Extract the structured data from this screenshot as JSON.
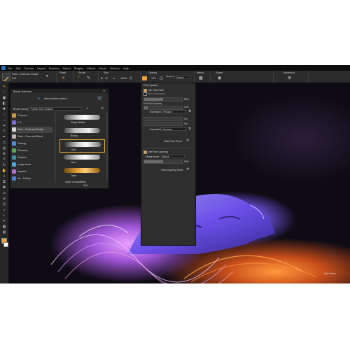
{
  "menubar": {
    "items": [
      "File",
      "Edit",
      "Canvas",
      "Layers",
      "Brushes",
      "Select",
      "Shapes",
      "Effects",
      "Movie",
      "Window",
      "Help"
    ]
  },
  "propbar": {
    "brush_category": "Paint - Build and Sculpt",
    "brush_variant": "Soft",
    "sections": {
      "reset": "Reset",
      "stroke": "Stroke",
      "size": "Size",
      "opacity": "Opacity",
      "media": "Media",
      "shape": "Shape",
      "advanced": "Advanced"
    },
    "size_value": "20",
    "opacity_value": "13%",
    "percent_2": "100%",
    "merge_mode_label": "Merge mode",
    "merge_mode_value": "Default"
  },
  "brush_selector": {
    "title": "Brush Selector",
    "new_brushes": "New brushes added...",
    "library_label": "Brush Library:",
    "library_value": "Painter 2021 Brushes",
    "categories": [
      {
        "label": "Crayons",
        "color": "#c99a3c"
      },
      {
        "label": "F-X",
        "color": "#7a6bd8"
      },
      {
        "label": "Paint - Build and Sculpt",
        "color": "#d8d8d8"
      },
      {
        "label": "Paint - Pure and Blend",
        "color": "#b8b8b8"
      },
      {
        "label": "Glazing",
        "color": "#4f8ad6"
      },
      {
        "label": "Gouache",
        "color": "#59a65f"
      },
      {
        "label": "Graphic",
        "color": "#3f8fa8"
      },
      {
        "label": "Image Hose",
        "color": "#46a8d8"
      },
      {
        "label": "Impasto",
        "color": "#b06fd0"
      },
      {
        "label": "Ink - Rolltop",
        "color": "#4a7fd0"
      }
    ],
    "variants": [
      {
        "label": "Shape Builder"
      },
      {
        "label": "Blocky"
      },
      {
        "label": "Soft"
      },
      {
        "label": "Hard"
      },
      {
        "label": "Taper"
      }
    ],
    "layer_compat": "Layer compatibility",
    "layer_compat_value": "Soft"
  },
  "opacity_panel": {
    "paint_opacity": "Paint Opacity",
    "use_fluid_paint": "Use Fluid Paint",
    "fill_to_flat": "Fill to Flat layers",
    "paint_opacity_row": "Paint Opacity",
    "paint_opacity_val": "50%",
    "min_fluid_opacity": "Min Fluid Opacity",
    "min_fluid_val": "10%",
    "expression_label": "Expression",
    "expression_value": "Pressure",
    "row_a": "Accumulation",
    "row_a_val": "0%",
    "row_b": "Min Accumulation",
    "row_b_val": "0%",
    "expression2_value": "Pressure",
    "fluid_paint_reset": "Fluid Paint Reset",
    "use_paint_layering": "Use Paint Layering",
    "merge_mode_label": "Merge mode",
    "merge_mode_value": "Default",
    "paint_layer_opacity": "Paint Layer Opacity",
    "paint_layer_val": "50%",
    "paint_layering_reset": "Paint Layering Reset"
  },
  "canvas": {
    "signature": "Aleh Bear"
  },
  "colors": {
    "accent": "#e8a33b",
    "bg": "#1c1c1c",
    "panel": "#2c2c2c"
  }
}
